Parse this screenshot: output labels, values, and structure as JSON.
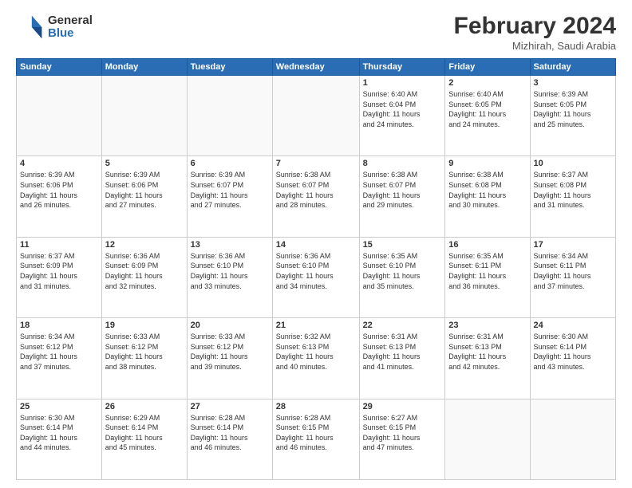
{
  "header": {
    "logo_general": "General",
    "logo_blue": "Blue",
    "month_year": "February 2024",
    "location": "Mizhirah, Saudi Arabia"
  },
  "weekdays": [
    "Sunday",
    "Monday",
    "Tuesday",
    "Wednesday",
    "Thursday",
    "Friday",
    "Saturday"
  ],
  "weeks": [
    [
      {
        "day": "",
        "info": ""
      },
      {
        "day": "",
        "info": ""
      },
      {
        "day": "",
        "info": ""
      },
      {
        "day": "",
        "info": ""
      },
      {
        "day": "1",
        "info": "Sunrise: 6:40 AM\nSunset: 6:04 PM\nDaylight: 11 hours\nand 24 minutes."
      },
      {
        "day": "2",
        "info": "Sunrise: 6:40 AM\nSunset: 6:05 PM\nDaylight: 11 hours\nand 24 minutes."
      },
      {
        "day": "3",
        "info": "Sunrise: 6:39 AM\nSunset: 6:05 PM\nDaylight: 11 hours\nand 25 minutes."
      }
    ],
    [
      {
        "day": "4",
        "info": "Sunrise: 6:39 AM\nSunset: 6:06 PM\nDaylight: 11 hours\nand 26 minutes."
      },
      {
        "day": "5",
        "info": "Sunrise: 6:39 AM\nSunset: 6:06 PM\nDaylight: 11 hours\nand 27 minutes."
      },
      {
        "day": "6",
        "info": "Sunrise: 6:39 AM\nSunset: 6:07 PM\nDaylight: 11 hours\nand 27 minutes."
      },
      {
        "day": "7",
        "info": "Sunrise: 6:38 AM\nSunset: 6:07 PM\nDaylight: 11 hours\nand 28 minutes."
      },
      {
        "day": "8",
        "info": "Sunrise: 6:38 AM\nSunset: 6:07 PM\nDaylight: 11 hours\nand 29 minutes."
      },
      {
        "day": "9",
        "info": "Sunrise: 6:38 AM\nSunset: 6:08 PM\nDaylight: 11 hours\nand 30 minutes."
      },
      {
        "day": "10",
        "info": "Sunrise: 6:37 AM\nSunset: 6:08 PM\nDaylight: 11 hours\nand 31 minutes."
      }
    ],
    [
      {
        "day": "11",
        "info": "Sunrise: 6:37 AM\nSunset: 6:09 PM\nDaylight: 11 hours\nand 31 minutes."
      },
      {
        "day": "12",
        "info": "Sunrise: 6:36 AM\nSunset: 6:09 PM\nDaylight: 11 hours\nand 32 minutes."
      },
      {
        "day": "13",
        "info": "Sunrise: 6:36 AM\nSunset: 6:10 PM\nDaylight: 11 hours\nand 33 minutes."
      },
      {
        "day": "14",
        "info": "Sunrise: 6:36 AM\nSunset: 6:10 PM\nDaylight: 11 hours\nand 34 minutes."
      },
      {
        "day": "15",
        "info": "Sunrise: 6:35 AM\nSunset: 6:10 PM\nDaylight: 11 hours\nand 35 minutes."
      },
      {
        "day": "16",
        "info": "Sunrise: 6:35 AM\nSunset: 6:11 PM\nDaylight: 11 hours\nand 36 minutes."
      },
      {
        "day": "17",
        "info": "Sunrise: 6:34 AM\nSunset: 6:11 PM\nDaylight: 11 hours\nand 37 minutes."
      }
    ],
    [
      {
        "day": "18",
        "info": "Sunrise: 6:34 AM\nSunset: 6:12 PM\nDaylight: 11 hours\nand 37 minutes."
      },
      {
        "day": "19",
        "info": "Sunrise: 6:33 AM\nSunset: 6:12 PM\nDaylight: 11 hours\nand 38 minutes."
      },
      {
        "day": "20",
        "info": "Sunrise: 6:33 AM\nSunset: 6:12 PM\nDaylight: 11 hours\nand 39 minutes."
      },
      {
        "day": "21",
        "info": "Sunrise: 6:32 AM\nSunset: 6:13 PM\nDaylight: 11 hours\nand 40 minutes."
      },
      {
        "day": "22",
        "info": "Sunrise: 6:31 AM\nSunset: 6:13 PM\nDaylight: 11 hours\nand 41 minutes."
      },
      {
        "day": "23",
        "info": "Sunrise: 6:31 AM\nSunset: 6:13 PM\nDaylight: 11 hours\nand 42 minutes."
      },
      {
        "day": "24",
        "info": "Sunrise: 6:30 AM\nSunset: 6:14 PM\nDaylight: 11 hours\nand 43 minutes."
      }
    ],
    [
      {
        "day": "25",
        "info": "Sunrise: 6:30 AM\nSunset: 6:14 PM\nDaylight: 11 hours\nand 44 minutes."
      },
      {
        "day": "26",
        "info": "Sunrise: 6:29 AM\nSunset: 6:14 PM\nDaylight: 11 hours\nand 45 minutes."
      },
      {
        "day": "27",
        "info": "Sunrise: 6:28 AM\nSunset: 6:14 PM\nDaylight: 11 hours\nand 46 minutes."
      },
      {
        "day": "28",
        "info": "Sunrise: 6:28 AM\nSunset: 6:15 PM\nDaylight: 11 hours\nand 46 minutes."
      },
      {
        "day": "29",
        "info": "Sunrise: 6:27 AM\nSunset: 6:15 PM\nDaylight: 11 hours\nand 47 minutes."
      },
      {
        "day": "",
        "info": ""
      },
      {
        "day": "",
        "info": ""
      }
    ]
  ]
}
